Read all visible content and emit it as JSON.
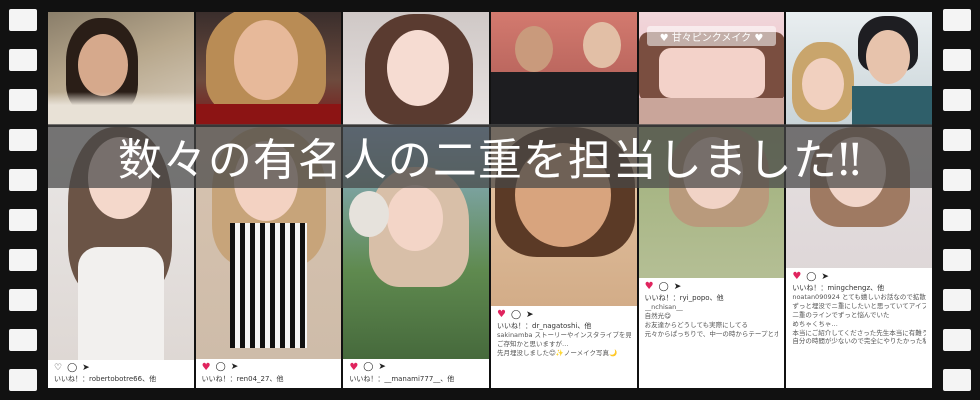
{
  "headline": "数々の有名人の二重を担当しました‼",
  "tile_tags": {
    "pink_makeup": "♥ 甘々ピンクメイク ♥"
  },
  "ig_cards": [
    {
      "user": "いいね！：robertobotre66、他",
      "lines": []
    },
    {
      "user": "いいね！：ren04_27、他",
      "lines": []
    },
    {
      "user": "いいね！：__manami777__、他",
      "lines": []
    },
    {
      "user": "いいね！：dr_nagatoshi、他",
      "lines": [
        "sakinamba ストーリーやインスタライブを見てくださってた方は",
        "ご存知かと思いますが…",
        "先月埋没しました😊✨ノーメイク写真🌙"
      ]
    },
    {
      "user": "いいね！：ryi_popo、他",
      "lines": [
        "__nchisan__",
        "自然光😋",
        "",
        "お友達からどうしても実際にしてる",
        "元々からぱっちりで、中一の時からテープとホノリのアイプチ"
      ]
    },
    {
      "user": "いいね！：mingchengz、他",
      "lines": [
        "noatan090924 とても嬉しいお話なので拡散します",
        "ずっと埋没でニ重にしたいと思っていてアイプチを使っていました",
        "二重のラインでずっと悩んでいた",
        "めちゃくちゃ…",
        "本当にご紹介してくださった先生本当に有難うございます",
        "自分の時間が少ないので完全にやりたかった私は…"
      ]
    }
  ],
  "colors": {
    "film": "#111111",
    "perforation": "#f4f4f4",
    "band": "#464646",
    "heart": "#e0245e"
  }
}
